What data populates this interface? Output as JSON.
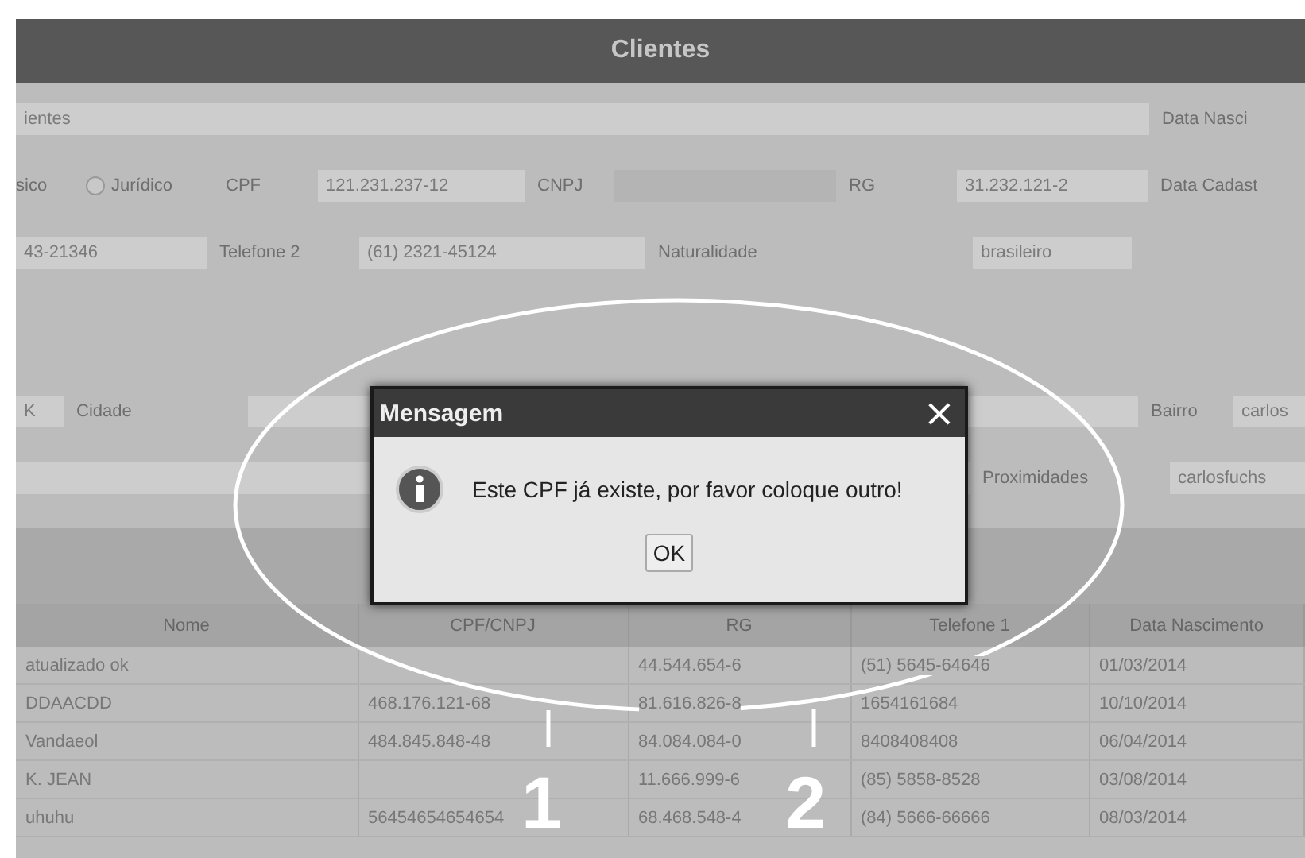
{
  "window": {
    "title": "Clientes"
  },
  "form": [
    [
      {
        "kind": "field",
        "value": "ientes"
      },
      {
        "kind": "label",
        "text": "Data Nasci"
      }
    ],
    [
      {
        "kind": "label",
        "text": "sico"
      },
      {
        "kind": "radio",
        "text": "Jurídico",
        "selected": false
      },
      {
        "kind": "label",
        "text": "CPF"
      },
      {
        "kind": "field",
        "value": "121.231.237-12"
      },
      {
        "kind": "label",
        "text": "CNPJ"
      },
      {
        "kind": "field",
        "disabled": true
      },
      {
        "kind": "label",
        "text": "RG"
      },
      {
        "kind": "field",
        "value": "31.232.121-2"
      },
      {
        "kind": "label",
        "text": "Data Cadast"
      }
    ],
    [
      {
        "kind": "field",
        "value": "43-21346"
      },
      {
        "kind": "label",
        "text": "Telefone 2"
      },
      {
        "kind": "field",
        "value": "(61) 2321-45124"
      },
      {
        "kind": "label",
        "text": "Naturalidade"
      },
      {
        "kind": "field",
        "value": "brasileiro"
      }
    ],
    [
      {
        "kind": "field",
        "value": "K"
      },
      {
        "kind": "label",
        "text": "Cidade"
      },
      {
        "kind": "field"
      },
      {
        "kind": "label",
        "text": "Bairro"
      },
      {
        "kind": "field",
        "value": "carlos"
      }
    ],
    [
      {
        "kind": "field"
      },
      {
        "kind": "label",
        "text": "Proximidades"
      },
      {
        "kind": "field",
        "value": "carlosfuchs"
      }
    ]
  ],
  "table": {
    "columns": [
      "Nome",
      "CPF/CNPJ",
      "RG",
      "Telefone 1",
      "Data Nascimento"
    ],
    "rows": [
      [
        "atualizado ok",
        "",
        "44.544.654-6",
        "(51) 5645-64646",
        "01/03/2014"
      ],
      [
        "DDAACDD",
        "468.176.121-68",
        "81.616.826-8",
        "1654161684",
        "10/10/2014"
      ],
      [
        "Vandaeol",
        "484.845.848-48",
        "84.084.084-0",
        "8408408408",
        "06/04/2014"
      ],
      [
        "K. JEAN",
        "",
        "11.666.999-6",
        "(85) 5858-8528",
        "03/08/2014"
      ],
      [
        "uhuhu",
        "56454654654654",
        "68.468.548-4",
        "(84) 5666-66666",
        "08/03/2014"
      ]
    ]
  },
  "dialog": {
    "title": "Mensagem",
    "close": "×",
    "message": "Este CPF já existe, por favor coloque outro!",
    "button": "OK"
  },
  "callouts": [
    "1",
    "2"
  ]
}
